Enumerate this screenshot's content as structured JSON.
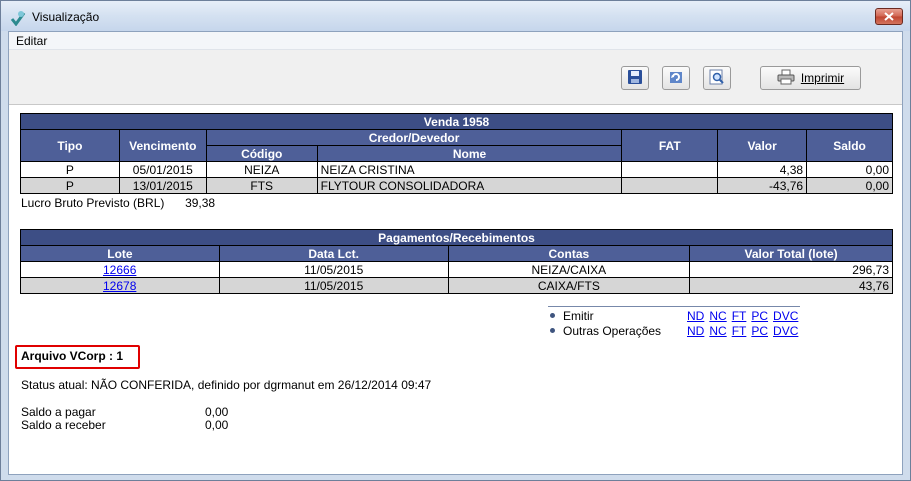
{
  "window": {
    "title": "Visualização",
    "app_icon": "app-logo-icon",
    "close_icon": "close-icon"
  },
  "menu": {
    "items": [
      "Editar"
    ]
  },
  "toolbar": {
    "icons": [
      "save-icon",
      "refresh-icon",
      "zoom-icon"
    ],
    "print_label": "Imprimir",
    "print_icon": "printer-icon"
  },
  "sale": {
    "title": "Venda  1958",
    "headers": {
      "tipo": "Tipo",
      "vencimento": "Vencimento",
      "credor": "Credor/Devedor",
      "fat": "FAT",
      "valor": "Valor",
      "saldo": "Saldo",
      "codigo": "Código",
      "nome": "Nome"
    },
    "rows": [
      {
        "tipo": "P",
        "vencimento": "05/01/2015",
        "codigo": "NEIZA",
        "nome": "NEIZA CRISTINA",
        "fat": "",
        "valor": "4,38",
        "saldo": "0,00"
      },
      {
        "tipo": "P",
        "vencimento": "13/01/2015",
        "codigo": "FTS",
        "nome": "FLYTOUR CONSOLIDADORA",
        "fat": "",
        "valor": "-43,76",
        "saldo": "0,00"
      }
    ]
  },
  "lucro": {
    "label": "Lucro Bruto Previsto (BRL)",
    "value": "39,38"
  },
  "payments": {
    "title": "Pagamentos/Recebimentos",
    "headers": {
      "lote": "Lote",
      "data": "Data Lct.",
      "contas": "Contas",
      "valor": "Valor Total (lote)"
    },
    "rows": [
      {
        "lote": "12666",
        "data": "11/05/2015",
        "contas": "NEIZA/CAIXA",
        "valor": "296,73"
      },
      {
        "lote": "12678",
        "data": "11/05/2015",
        "contas": "CAIXA/FTS",
        "valor": "43,76"
      }
    ]
  },
  "operations": [
    {
      "label": "Emitir",
      "links": [
        "ND",
        "NC",
        "FT",
        "PC",
        "DVC"
      ]
    },
    {
      "label": "Outras Operações",
      "links": [
        "ND",
        "NC",
        "FT",
        "PC",
        "DVC"
      ]
    }
  ],
  "vcorp": "Arquivo VCorp : 1",
  "status": "Status atual: NÃO CONFERIDA, definido por dgrmanut em 26/12/2014 09:47",
  "balances": [
    {
      "label": "Saldo a pagar",
      "value": "0,00"
    },
    {
      "label": "Saldo a receber",
      "value": "0,00"
    }
  ],
  "colors": {
    "header_blue": "#4e5f98",
    "row_alt": "#d6d6d6",
    "highlight_red": "#e00000",
    "link": "#0000ee"
  }
}
